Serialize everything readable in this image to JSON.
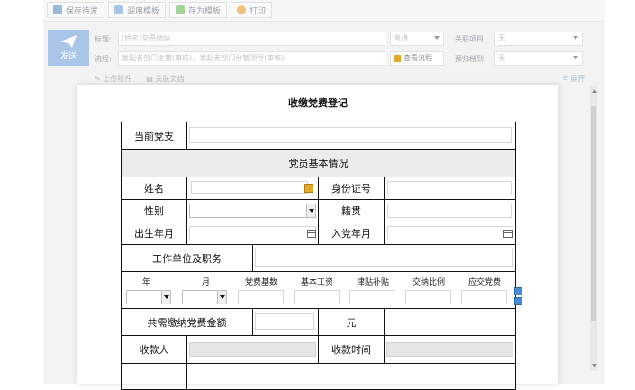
{
  "toolbar": {
    "save_label": "保存待发",
    "load_template_label": "调用模板",
    "save_template_label": "存为模板",
    "print_label": "打印"
  },
  "send_label": "发送",
  "header": {
    "title_label": "标题:",
    "title_value": "(姓名)党费缴纳",
    "flow_label": "流程:",
    "flow_placeholder": "发起者部门主管(审核)、发起者部门分管领导(审核)",
    "level_value": "普通",
    "related_project_label": "关联项目:",
    "related_project_value": "无",
    "view_flow_label": "查看流程",
    "archive_label": "预归档到:",
    "archive_value": "无",
    "upload_label": "上传附件",
    "related_doc_label": "关联文档",
    "expand_label": "展开"
  },
  "form": {
    "title": "收缴党费登记",
    "current_branch": "当前党支",
    "basic_info": "党员基本情况",
    "name": "姓名",
    "id_number": "身份证号",
    "gender": "性别",
    "native_place": "籍贯",
    "birth_date": "出生年月",
    "join_date": "入党年月",
    "work_unit": "工作单位及职务",
    "sub_headers": [
      "年",
      "月",
      "党费基数",
      "基本工资",
      "津贴补贴",
      "交纳比例",
      "应交党费"
    ],
    "total_label": "共需缴纳党费金额",
    "yuan": "元",
    "payee": "收款人",
    "pay_time": "收款时间"
  },
  "colors": {
    "accent": "#a9c6e8",
    "border": "#111111",
    "section_bg": "#ececec"
  }
}
